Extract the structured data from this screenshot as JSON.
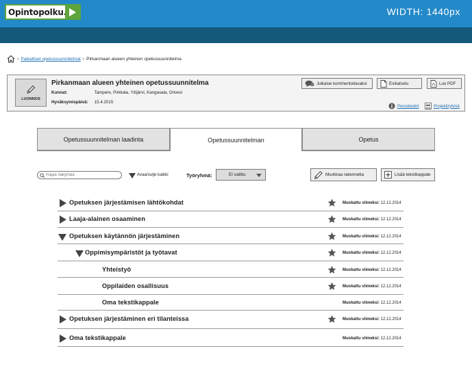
{
  "header": {
    "logo": "Opintopolku.fi",
    "width_label": "WIDTH: 1440px"
  },
  "breadcrumb": {
    "items": [
      "Paikalliset opetussuunnitelmat",
      "Pirkanmaan alueen yhteinen opetussuunnitelma"
    ]
  },
  "info": {
    "status": "LUONNOS",
    "title": "Pirkanmaan alueen yhteinen opetussuunnitelma",
    "municipalities_label": "Kunnat:",
    "municipalities": "Tampere, Pirkkala, Ylöjärvi, Kangasala, Orivesi",
    "approval_label": "Hyväksymispäivä:",
    "approval_date": "15.4.2015",
    "buttons": {
      "publish": "Julkaise kommentoitavaksi",
      "preview": "Esikatselu",
      "pdf": "Luo PDF"
    },
    "links": {
      "basic_info": "Perustiedot",
      "project_group": "Projektiryhmä"
    }
  },
  "tabs": [
    {
      "label": "Opetussuunnitelman laadinta",
      "active": false
    },
    {
      "label": "Opetussuunnitelman",
      "active": true
    },
    {
      "label": "Opetus",
      "active": false
    }
  ],
  "toolbar": {
    "search_placeholder": "Rajaa näkymää",
    "expand_label": "Avaa/sulje kaikki",
    "workgroup_label": "Työryhmä:",
    "workgroup_value": "Ei valittu",
    "edit_structure": "Muokkaa rakennetta",
    "add_text": "Lisää tekstikappale"
  },
  "tree": {
    "modified_label": "Muokattu viimeksi:",
    "rows": [
      {
        "label": "Opetuksen järjestämisen lähtökohdat",
        "date": "12.12.2014",
        "star": true,
        "level": 0,
        "toggle": "collapsed"
      },
      {
        "label": "Laaja-alainen osaaminen",
        "date": "12.12.2014",
        "star": true,
        "level": 0,
        "toggle": "collapsed"
      },
      {
        "label": "Opetuksen käytännön järjestäminen",
        "date": "12.12.2014",
        "star": true,
        "level": 0,
        "toggle": "expanded"
      },
      {
        "label": "Oppimisympäristöt ja työtavat",
        "date": "12.12.2014",
        "star": true,
        "level": 1,
        "toggle": "expanded"
      },
      {
        "label": "Yhteistyö",
        "date": "12.12.2014",
        "star": true,
        "level": 2,
        "toggle": "none"
      },
      {
        "label": "Oppilaiden osallisuus",
        "date": "12.12.2014",
        "star": true,
        "level": 2,
        "toggle": "none"
      },
      {
        "label": "Oma tekstikappale",
        "date": "12.12.2014",
        "star": false,
        "level": 2,
        "toggle": "none"
      },
      {
        "label": "Opetuksen järjestäminen eri tilanteissa",
        "date": "12.12.2014",
        "star": true,
        "level": 0,
        "toggle": "collapsed"
      },
      {
        "label": "Oma tekstikappale",
        "date": "12.12.2014",
        "star": false,
        "level": 0,
        "toggle": "collapsed"
      }
    ]
  }
}
